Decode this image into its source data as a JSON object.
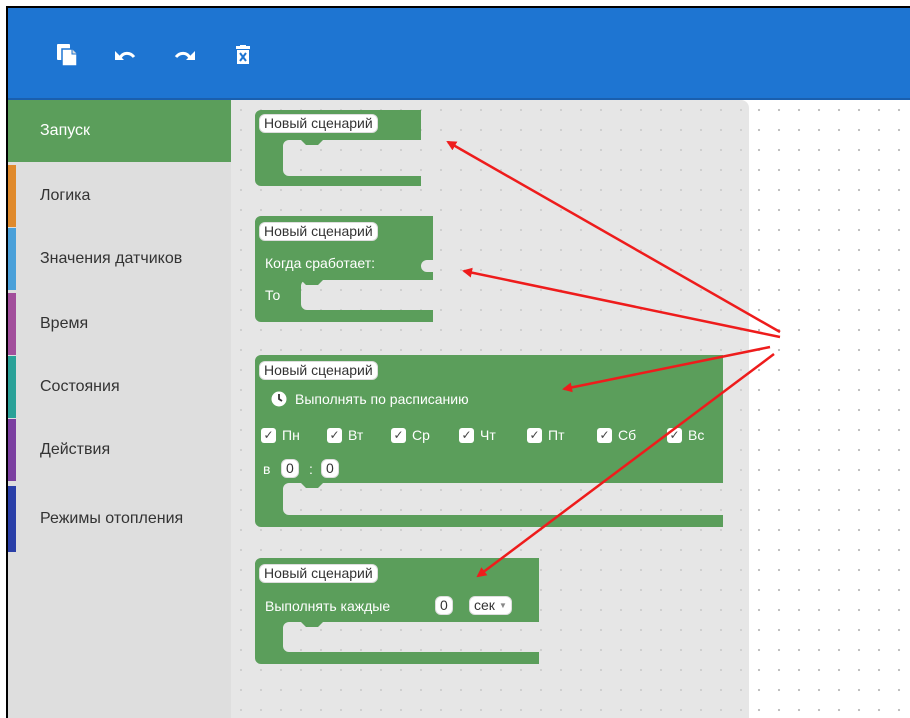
{
  "categories": [
    {
      "label": "Запуск",
      "color": "#5b9e5b"
    },
    {
      "label": "Логика",
      "color": "#e08a2c"
    },
    {
      "label": "Значения датчиков",
      "color": "#4aa0d9"
    },
    {
      "label": "Время",
      "color": "#a24f9c"
    },
    {
      "label": "Состояния",
      "color": "#2aa198"
    },
    {
      "label": "Действия",
      "color": "#7b3fa0"
    },
    {
      "label": "Режимы отопления",
      "color": "#2a3fa8"
    }
  ],
  "toolbar": {
    "icons": [
      "paste-icon",
      "undo-icon",
      "redo-icon",
      "delete-icon"
    ]
  },
  "blocks": {
    "b1": {
      "name": "Новый сценарий"
    },
    "b2": {
      "name": "Новый сценарий",
      "when": "Когда сработает:",
      "then": "То"
    },
    "b3": {
      "name": "Новый сценарий",
      "schedule": "Выполнять по расписанию",
      "days": [
        "Пн",
        "Вт",
        "Ср",
        "Чт",
        "Пт",
        "Сб",
        "Вс"
      ],
      "at": "в",
      "hour": "0",
      "sep": ":",
      "minute": "0"
    },
    "b4": {
      "name": "Новый сценарий",
      "every": "Выполнять каждые",
      "value": "0",
      "unit": "сек"
    }
  },
  "colors": {
    "block": "#5b9e5b",
    "toolbar": "#1e75d2",
    "arrow": "#ee1c1c"
  }
}
